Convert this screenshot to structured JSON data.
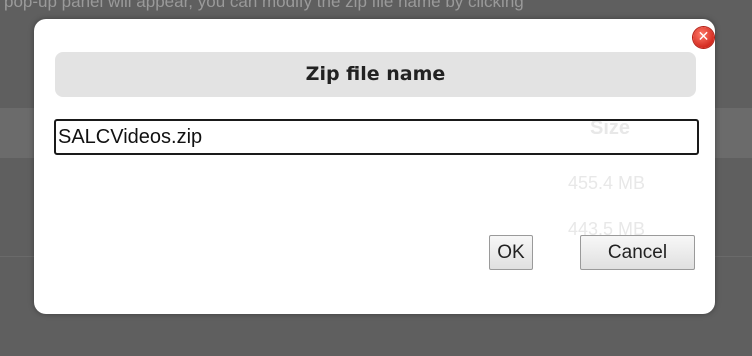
{
  "background": {
    "top_text": "pop-up panel will appear, you can modify the zip file name by clicking"
  },
  "dialog": {
    "title": "Zip file name",
    "close_glyph": "✕",
    "input_value": "SALCVideos.zip",
    "ok_label": "OK",
    "cancel_label": "Cancel"
  },
  "ghost": {
    "size_header": "Size",
    "row1_size": "455.4 MB",
    "row2_size": "443.5 MB"
  },
  "colors": {
    "overlay": "#5f5f5f",
    "dialog_bg": "#ffffff",
    "title_bg": "#e3e3e3",
    "close_red": "#d42a1f"
  },
  "icons": {
    "close": "close-icon"
  }
}
